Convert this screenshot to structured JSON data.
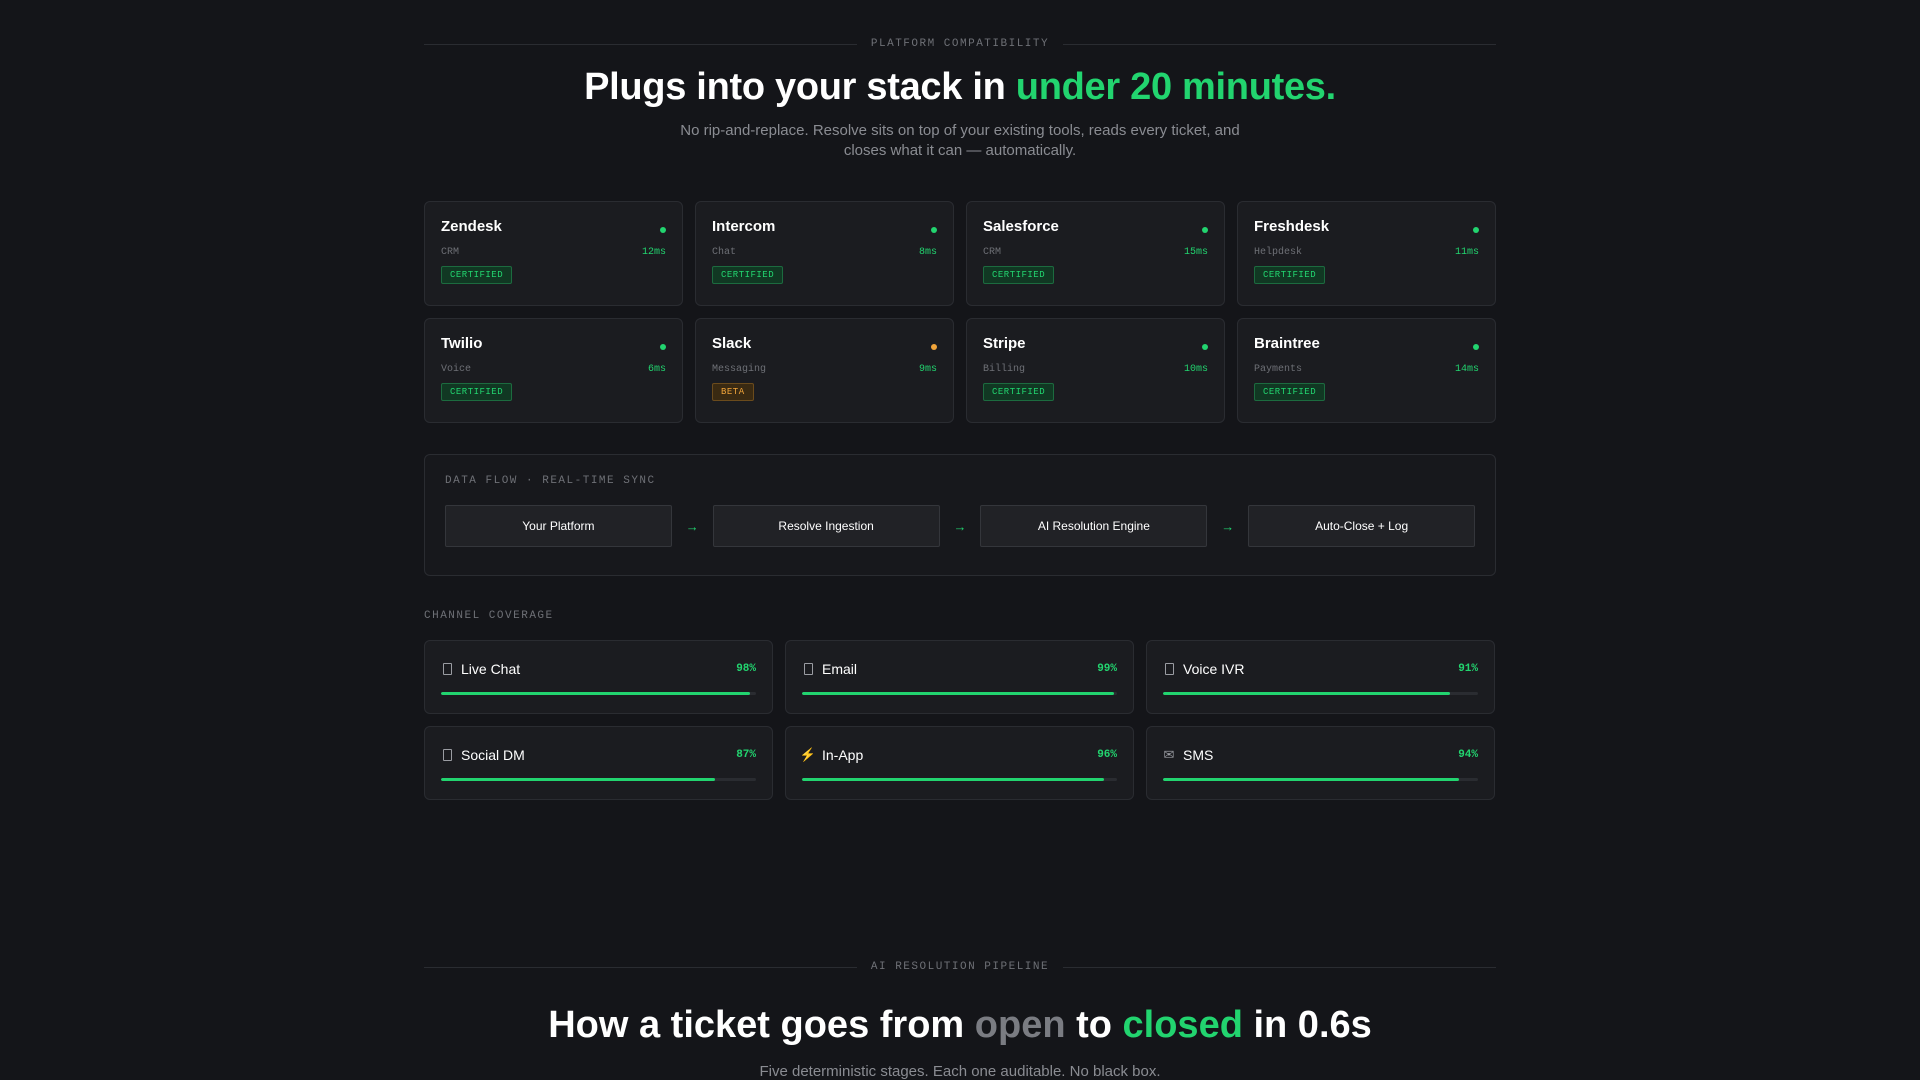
{
  "compat": {
    "eyebrow": "PLATFORM COMPATIBILITY",
    "title_a": "Plugs into your stack in ",
    "title_b": "under 20 minutes.",
    "subtitle": "No rip-and-replace. Resolve sits on top of your existing tools, reads every ticket, and closes what it can — automatically."
  },
  "integrations": [
    {
      "name": "Zendesk",
      "category": "CRM",
      "latency": "12ms",
      "badge": "CERTIFIED",
      "status": "certified"
    },
    {
      "name": "Intercom",
      "category": "Chat",
      "latency": "8ms",
      "badge": "CERTIFIED",
      "status": "certified"
    },
    {
      "name": "Salesforce",
      "category": "CRM",
      "latency": "15ms",
      "badge": "CERTIFIED",
      "status": "certified"
    },
    {
      "name": "Freshdesk",
      "category": "Helpdesk",
      "latency": "11ms",
      "badge": "CERTIFIED",
      "status": "certified"
    },
    {
      "name": "Twilio",
      "category": "Voice",
      "latency": "6ms",
      "badge": "CERTIFIED",
      "status": "certified"
    },
    {
      "name": "Slack",
      "category": "Messaging",
      "latency": "9ms",
      "badge": "BETA",
      "status": "beta"
    },
    {
      "name": "Stripe",
      "category": "Billing",
      "latency": "10ms",
      "badge": "CERTIFIED",
      "status": "certified"
    },
    {
      "name": "Braintree",
      "category": "Payments",
      "latency": "14ms",
      "badge": "CERTIFIED",
      "status": "certified"
    }
  ],
  "flow": {
    "label": "DATA FLOW · REAL-TIME SYNC",
    "steps": [
      "Your Platform",
      "Resolve Ingestion",
      "AI Resolution Engine",
      "Auto-Close + Log"
    ],
    "arrow": "→"
  },
  "channels": {
    "label": "CHANNEL COVERAGE",
    "items": [
      {
        "name": "Live Chat",
        "pct": "98%",
        "value": 98,
        "icon": "box"
      },
      {
        "name": "Email",
        "pct": "99%",
        "value": 99,
        "icon": "box"
      },
      {
        "name": "Voice IVR",
        "pct": "91%",
        "value": 91,
        "icon": "box"
      },
      {
        "name": "Social DM",
        "pct": "87%",
        "value": 87,
        "icon": "box"
      },
      {
        "name": "In-App",
        "pct": "96%",
        "value": 96,
        "icon": "⚡"
      },
      {
        "name": "SMS",
        "pct": "94%",
        "value": 94,
        "icon": "✉"
      }
    ]
  },
  "pipeline": {
    "eyebrow": "AI RESOLUTION PIPELINE",
    "title_a": "How a ticket goes from ",
    "title_open": "open",
    "title_to": " to ",
    "title_closed": "closed",
    "title_end": " in 0.6s",
    "subtitle": "Five deterministic stages. Each one auditable. No black box."
  },
  "colors": {
    "accent": "#22d46f",
    "beta": "#f0a43a"
  }
}
